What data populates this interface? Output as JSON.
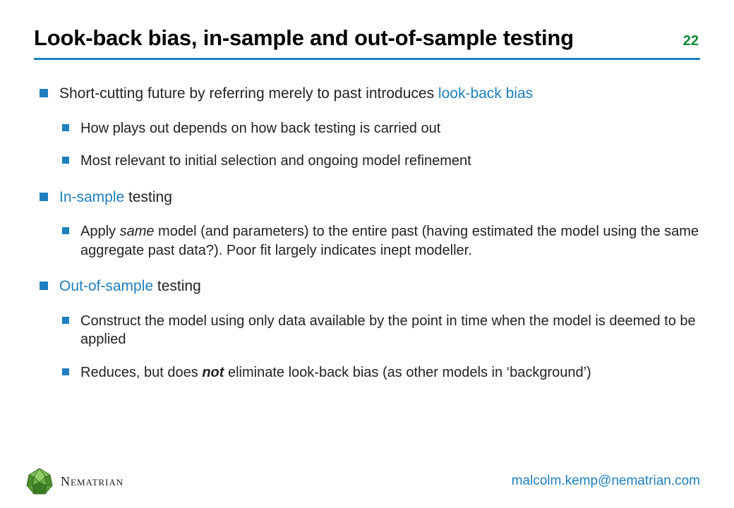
{
  "slide": {
    "title": "Look-back bias, in-sample and out-of-sample testing",
    "pageNumber": "22"
  },
  "content": {
    "b1_pre": "Short-cutting future by referring merely to past introduces ",
    "b1_hl": "look-back bias",
    "b1_sub1": "How plays out depends on how back testing is carried out",
    "b1_sub2": "Most relevant  to initial selection and ongoing model refinement",
    "b2_hl": "In-sample",
    "b2_post": " testing",
    "b2_sub1_a": "Apply ",
    "b2_sub1_it": "same",
    "b2_sub1_b": " model (and parameters) to the entire past (having estimated the model using the same aggregate past data?). Poor fit largely indicates inept modeller.",
    "b3_hl": "Out-of-sample",
    "b3_post": " testing",
    "b3_sub1": "Construct the model using only data available by the point in time when the model is deemed to be applied",
    "b3_sub2_a": "Reduces, but does ",
    "b3_sub2_bi": "not",
    "b3_sub2_b": " eliminate look-back bias (as other models in ‘background’)"
  },
  "footer": {
    "brand": "Nematrian",
    "email": "malcolm.kemp@nematrian.com"
  }
}
